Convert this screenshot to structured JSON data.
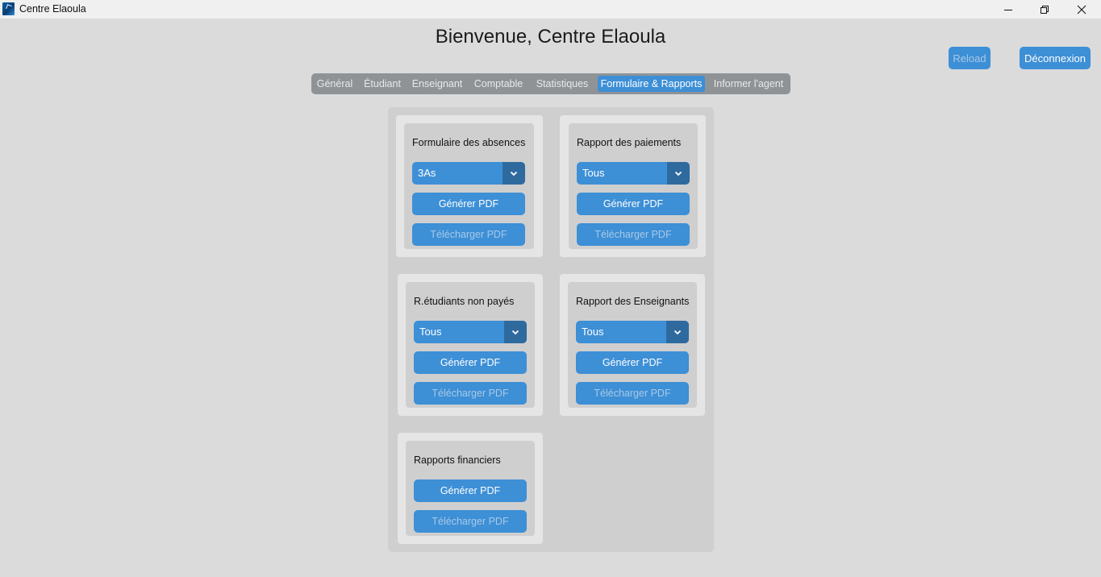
{
  "window": {
    "title": "Centre Elaoula"
  },
  "header": {
    "title": "Bienvenue, Centre Elaoula",
    "reload_label": "Reload",
    "logout_label": "Déconnexion"
  },
  "tabs": [
    {
      "label": "Général",
      "active": false
    },
    {
      "label": "Étudiant",
      "active": false
    },
    {
      "label": "Enseignant",
      "active": false
    },
    {
      "label": "Comptable",
      "active": false
    },
    {
      "label": "Statistiques",
      "active": false
    },
    {
      "label": "Formulaire & Rapports",
      "active": true
    },
    {
      "label": "Informer l'agent",
      "active": false
    }
  ],
  "cards": [
    {
      "title": "Formulaire des absences",
      "select_value": "3As",
      "generate_label": "Générer PDF",
      "download_label": "Télécharger PDF"
    },
    {
      "title": "Rapport des paiements",
      "select_value": "Tous",
      "generate_label": "Générer PDF",
      "download_label": "Télécharger PDF"
    },
    {
      "title": "R.étudiants non payés",
      "select_value": "Tous",
      "generate_label": "Générer PDF",
      "download_label": "Télécharger PDF"
    },
    {
      "title": "Rapport des Enseignants",
      "select_value": "Tous",
      "generate_label": "Générer PDF",
      "download_label": "Télécharger PDF"
    },
    {
      "title": "Rapports financiers",
      "generate_label": "Générer PDF",
      "download_label": "Télécharger PDF"
    }
  ],
  "colors": {
    "accent": "#3d8fd6",
    "accent_dark": "#2f6a9f",
    "tabbar": "#8f9396",
    "background": "#dbdbdb"
  },
  "icons": {
    "app": "app-logo-icon",
    "minimize": "minimize-icon",
    "maximize": "restore-icon",
    "close": "close-icon",
    "dropdown": "chevron-down-icon"
  }
}
